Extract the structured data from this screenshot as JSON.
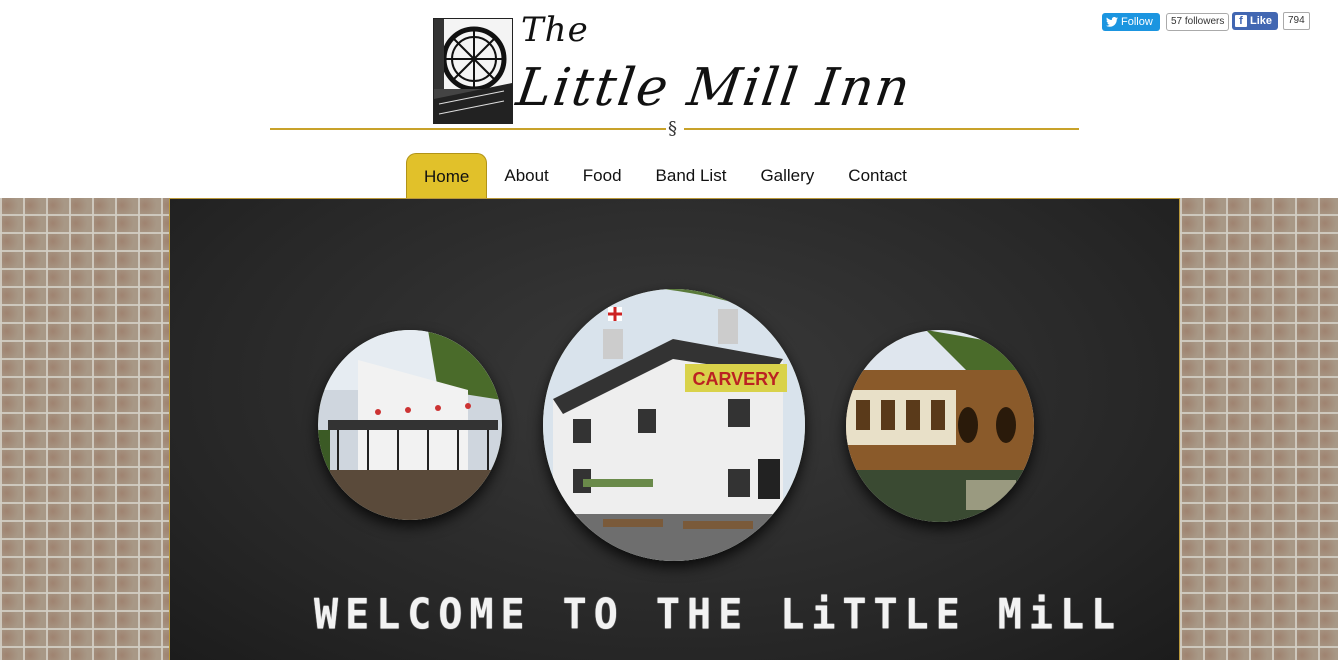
{
  "header": {
    "logo_the": "The",
    "logo_title": "Little  Mill  Inn",
    "section_mark": "§"
  },
  "nav": {
    "items": [
      {
        "label": "Home",
        "active": true
      },
      {
        "label": "About"
      },
      {
        "label": "Food"
      },
      {
        "label": "Band List"
      },
      {
        "label": "Gallery"
      },
      {
        "label": "Contact"
      }
    ]
  },
  "social": {
    "twitter_label": "Follow",
    "twitter_count": "57 followers",
    "facebook_label": "Like",
    "facebook_count": "794"
  },
  "hero": {
    "images": [
      {
        "icon": "pub-balcony-photo"
      },
      {
        "icon": "pub-front-photo",
        "sign_text": "CARVERY"
      },
      {
        "icon": "railway-carriage-photo"
      }
    ],
    "welcome_text": "WELCOME TO THE LiTTLE MiLL"
  },
  "colors": {
    "accent_gold": "#e1c12a",
    "rule_gold": "#c8a22a",
    "chalkboard": "#2a2a2a",
    "twitter_blue": "#1b95e0",
    "facebook_blue": "#4267b2"
  }
}
